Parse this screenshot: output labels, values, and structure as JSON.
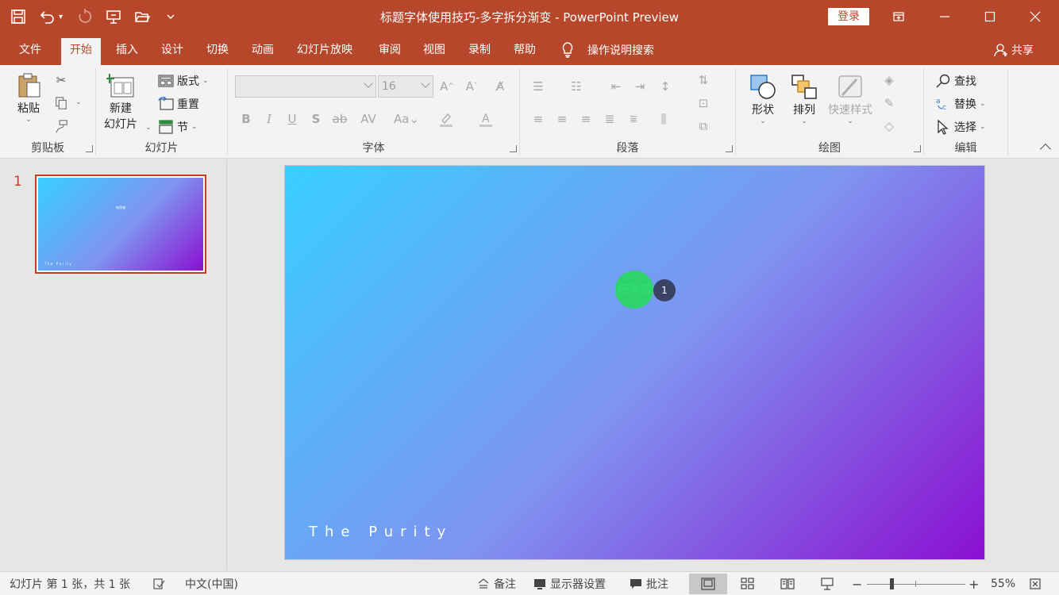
{
  "title_bar": {
    "document_title": "标题字体使用技巧-多字拆分渐变  -  PowerPoint Preview",
    "login_label": "登录",
    "qat_icons": [
      "save-icon",
      "undo-icon",
      "redo-icon",
      "present-icon",
      "open-icon",
      "customize-icon"
    ],
    "window_controls": [
      "ribbon-display-icon",
      "minimize-icon",
      "maximize-icon",
      "close-icon"
    ]
  },
  "tabs": [
    {
      "label": "文件",
      "active": false
    },
    {
      "label": "开始",
      "active": true
    },
    {
      "label": "插入",
      "active": false
    },
    {
      "label": "设计",
      "active": false
    },
    {
      "label": "切换",
      "active": false
    },
    {
      "label": "动画",
      "active": false
    },
    {
      "label": "幻灯片放映",
      "active": false
    },
    {
      "label": "审阅",
      "active": false
    },
    {
      "label": "视图",
      "active": false
    },
    {
      "label": "录制",
      "active": false
    },
    {
      "label": "帮助",
      "active": false
    }
  ],
  "tell_me": "操作说明搜索",
  "share_label": "共享",
  "ribbon": {
    "clipboard": {
      "label": "剪贴板",
      "paste": "粘贴"
    },
    "slides": {
      "label": "幻灯片",
      "new_slide_line1": "新建",
      "new_slide_line2": "幻灯片",
      "layout": "版式",
      "reset": "重置",
      "section": "节"
    },
    "font": {
      "label": "字体",
      "font_name": "",
      "font_size": "16"
    },
    "paragraph": {
      "label": "段落"
    },
    "drawing": {
      "label": "绘图",
      "shapes": "形状",
      "arrange": "排列",
      "quick_styles": "快速样式"
    },
    "editing": {
      "label": "编辑",
      "find": "查找",
      "replace": "替换",
      "select": "选择"
    }
  },
  "thumbnails": [
    {
      "number": "1",
      "title": "纯净感",
      "subtitle": "The Purity"
    }
  ],
  "slide": {
    "title": "纯净感",
    "animation_badge": "1",
    "subtitle": "The Purity",
    "gradient_colors": [
      "#38cffe",
      "#7f94f0",
      "#8b0fd1"
    ]
  },
  "status_bar": {
    "slide_info": "幻灯片 第 1 张，共 1 张",
    "language": "中文(中国)",
    "notes": "备注",
    "display_settings": "显示器设置",
    "comments": "批注",
    "zoom": "55%"
  },
  "colors": {
    "accent": "#b7472a",
    "ribbon_bg": "#f3f3f3",
    "selection": "#c43e1c"
  }
}
